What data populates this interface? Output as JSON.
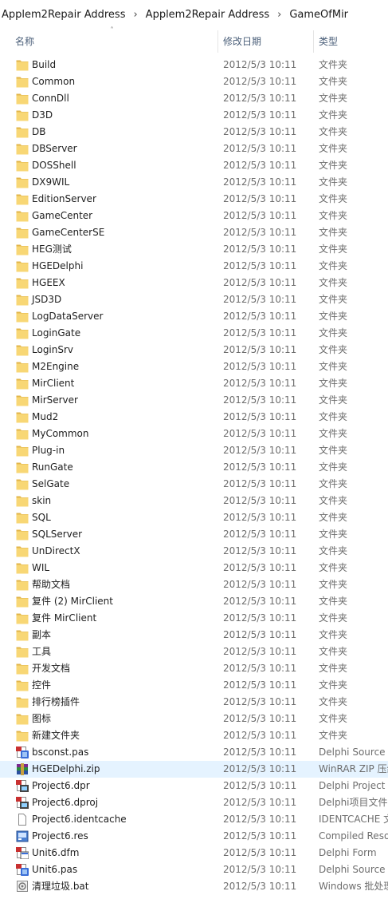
{
  "breadcrumb": [
    "Applem2Repair Address",
    "Applem2Repair Address",
    "GameOfMir"
  ],
  "columns": {
    "name": "名称",
    "date": "修改日期",
    "type": "类型"
  },
  "items": [
    {
      "name": "Build",
      "date": "2012/5/3 10:11",
      "type": "文件夹",
      "icon": "folder-icon"
    },
    {
      "name": "Common",
      "date": "2012/5/3 10:11",
      "type": "文件夹",
      "icon": "folder-icon"
    },
    {
      "name": "ConnDll",
      "date": "2012/5/3 10:11",
      "type": "文件夹",
      "icon": "folder-icon"
    },
    {
      "name": "D3D",
      "date": "2012/5/3 10:11",
      "type": "文件夹",
      "icon": "folder-icon"
    },
    {
      "name": "DB",
      "date": "2012/5/3 10:11",
      "type": "文件夹",
      "icon": "folder-icon"
    },
    {
      "name": "DBServer",
      "date": "2012/5/3 10:11",
      "type": "文件夹",
      "icon": "folder-icon"
    },
    {
      "name": "DOSShell",
      "date": "2012/5/3 10:11",
      "type": "文件夹",
      "icon": "folder-icon"
    },
    {
      "name": "DX9WIL",
      "date": "2012/5/3 10:11",
      "type": "文件夹",
      "icon": "folder-icon"
    },
    {
      "name": "EditionServer",
      "date": "2012/5/3 10:11",
      "type": "文件夹",
      "icon": "folder-icon"
    },
    {
      "name": "GameCenter",
      "date": "2012/5/3 10:11",
      "type": "文件夹",
      "icon": "folder-icon"
    },
    {
      "name": "GameCenterSE",
      "date": "2012/5/3 10:11",
      "type": "文件夹",
      "icon": "folder-icon"
    },
    {
      "name": "HEG测试",
      "date": "2012/5/3 10:11",
      "type": "文件夹",
      "icon": "folder-icon"
    },
    {
      "name": "HGEDelphi",
      "date": "2012/5/3 10:11",
      "type": "文件夹",
      "icon": "folder-icon"
    },
    {
      "name": "HGEEX",
      "date": "2012/5/3 10:11",
      "type": "文件夹",
      "icon": "folder-icon"
    },
    {
      "name": "JSD3D",
      "date": "2012/5/3 10:11",
      "type": "文件夹",
      "icon": "folder-icon"
    },
    {
      "name": "LogDataServer",
      "date": "2012/5/3 10:11",
      "type": "文件夹",
      "icon": "folder-icon"
    },
    {
      "name": "LoginGate",
      "date": "2012/5/3 10:11",
      "type": "文件夹",
      "icon": "folder-icon"
    },
    {
      "name": "LoginSrv",
      "date": "2012/5/3 10:11",
      "type": "文件夹",
      "icon": "folder-icon"
    },
    {
      "name": "M2Engine",
      "date": "2012/5/3 10:11",
      "type": "文件夹",
      "icon": "folder-icon"
    },
    {
      "name": "MirClient",
      "date": "2012/5/3 10:11",
      "type": "文件夹",
      "icon": "folder-icon"
    },
    {
      "name": "MirServer",
      "date": "2012/5/3 10:11",
      "type": "文件夹",
      "icon": "folder-icon"
    },
    {
      "name": "Mud2",
      "date": "2012/5/3 10:11",
      "type": "文件夹",
      "icon": "folder-icon"
    },
    {
      "name": "MyCommon",
      "date": "2012/5/3 10:11",
      "type": "文件夹",
      "icon": "folder-icon"
    },
    {
      "name": "Plug-in",
      "date": "2012/5/3 10:11",
      "type": "文件夹",
      "icon": "folder-icon"
    },
    {
      "name": "RunGate",
      "date": "2012/5/3 10:11",
      "type": "文件夹",
      "icon": "folder-icon"
    },
    {
      "name": "SelGate",
      "date": "2012/5/3 10:11",
      "type": "文件夹",
      "icon": "folder-icon"
    },
    {
      "name": "skin",
      "date": "2012/5/3 10:11",
      "type": "文件夹",
      "icon": "folder-icon"
    },
    {
      "name": "SQL",
      "date": "2012/5/3 10:11",
      "type": "文件夹",
      "icon": "folder-icon"
    },
    {
      "name": "SQLServer",
      "date": "2012/5/3 10:11",
      "type": "文件夹",
      "icon": "folder-icon"
    },
    {
      "name": "UnDirectX",
      "date": "2012/5/3 10:11",
      "type": "文件夹",
      "icon": "folder-icon"
    },
    {
      "name": "WIL",
      "date": "2012/5/3 10:11",
      "type": "文件夹",
      "icon": "folder-icon"
    },
    {
      "name": "帮助文档",
      "date": "2012/5/3 10:11",
      "type": "文件夹",
      "icon": "folder-icon"
    },
    {
      "name": "复件 (2) MirClient",
      "date": "2012/5/3 10:11",
      "type": "文件夹",
      "icon": "folder-icon"
    },
    {
      "name": "复件 MirClient",
      "date": "2012/5/3 10:11",
      "type": "文件夹",
      "icon": "folder-icon"
    },
    {
      "name": "副本",
      "date": "2012/5/3 10:11",
      "type": "文件夹",
      "icon": "folder-icon"
    },
    {
      "name": "工具",
      "date": "2012/5/3 10:11",
      "type": "文件夹",
      "icon": "folder-icon"
    },
    {
      "name": "开发文档",
      "date": "2012/5/3 10:11",
      "type": "文件夹",
      "icon": "folder-icon"
    },
    {
      "name": "控件",
      "date": "2012/5/3 10:11",
      "type": "文件夹",
      "icon": "folder-icon"
    },
    {
      "name": "排行榜插件",
      "date": "2012/5/3 10:11",
      "type": "文件夹",
      "icon": "folder-icon"
    },
    {
      "name": "图标",
      "date": "2012/5/3 10:11",
      "type": "文件夹",
      "icon": "folder-icon"
    },
    {
      "name": "新建文件夹",
      "date": "2012/5/3 10:11",
      "type": "文件夹",
      "icon": "folder-icon"
    },
    {
      "name": "bsconst.pas",
      "date": "2012/5/3 10:11",
      "type": "Delphi Source File",
      "icon": "delphi-source-icon"
    },
    {
      "name": "HGEDelphi.zip",
      "date": "2012/5/3 10:11",
      "type": "WinRAR ZIP 压缩文件",
      "icon": "winrar-zip-icon",
      "selected": true
    },
    {
      "name": "Project6.dpr",
      "date": "2012/5/3 10:11",
      "type": "Delphi Project File",
      "icon": "delphi-project-icon"
    },
    {
      "name": "Project6.dproj",
      "date": "2012/5/3 10:11",
      "type": "Delphi项目文件",
      "icon": "delphi-project-icon"
    },
    {
      "name": "Project6.identcache",
      "date": "2012/5/3 10:11",
      "type": "IDENTCACHE 文件",
      "icon": "blank-file-icon"
    },
    {
      "name": "Project6.res",
      "date": "2012/5/3 10:11",
      "type": "Compiled Resource",
      "icon": "compiled-resource-icon"
    },
    {
      "name": "Unit6.dfm",
      "date": "2012/5/3 10:11",
      "type": "Delphi Form",
      "icon": "delphi-form-icon"
    },
    {
      "name": "Unit6.pas",
      "date": "2012/5/3 10:11",
      "type": "Delphi Source File",
      "icon": "delphi-source-icon"
    },
    {
      "name": "清理垃圾.bat",
      "date": "2012/5/3 10:11",
      "type": "Windows 批处理文件",
      "icon": "batch-file-icon"
    }
  ],
  "colors": {
    "folder": "#f8d775",
    "folder_dark": "#e2b54a",
    "selection": "#e5f3ff",
    "header_text": "#4c607a"
  }
}
